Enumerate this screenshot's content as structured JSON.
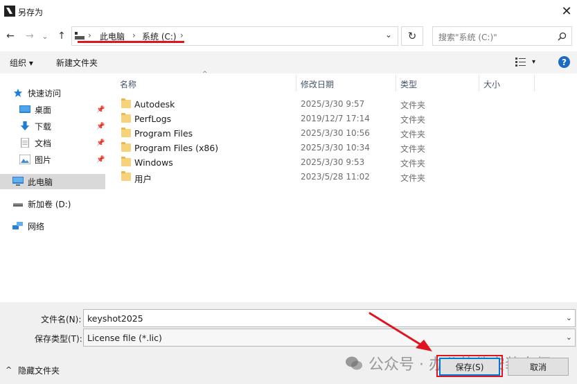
{
  "window": {
    "title": "另存为",
    "close": "✕"
  },
  "nav": {
    "back": "←",
    "forward": "→",
    "recent": "⌄",
    "up": "↑"
  },
  "address": {
    "segments": [
      "此电脑",
      "系统 (C:)"
    ],
    "separator": "›",
    "refresh": "↻",
    "dropdown": "⌄"
  },
  "search": {
    "placeholder": "搜索\"系统 (C:)\""
  },
  "toolbar": {
    "organize": "组织 ▾",
    "new_folder": "新建文件夹",
    "view_arrow": "▾",
    "help": "?"
  },
  "sidebar": {
    "quick_access": "快速访问",
    "items": [
      {
        "label": "桌面",
        "icon": "desktop-icon",
        "pinned": true
      },
      {
        "label": "下载",
        "icon": "download-icon",
        "pinned": true
      },
      {
        "label": "文档",
        "icon": "document-icon",
        "pinned": true
      },
      {
        "label": "图片",
        "icon": "pictures-icon",
        "pinned": true
      }
    ],
    "this_pc": "此电脑",
    "drive_d": "新加卷 (D:)",
    "network": "网络"
  },
  "columns": {
    "name": "名称",
    "date": "修改日期",
    "type": "类型",
    "size": "大小"
  },
  "files": [
    {
      "name": "Autodesk",
      "date": "2025/3/30 9:57",
      "type": "文件夹"
    },
    {
      "name": "PerfLogs",
      "date": "2019/12/7 17:14",
      "type": "文件夹"
    },
    {
      "name": "Program Files",
      "date": "2025/3/30 10:56",
      "type": "文件夹"
    },
    {
      "name": "Program Files (x86)",
      "date": "2025/3/30 10:34",
      "type": "文件夹"
    },
    {
      "name": "Windows",
      "date": "2025/3/30 9:53",
      "type": "文件夹"
    },
    {
      "name": "用户",
      "date": "2023/5/28 11:02",
      "type": "文件夹"
    }
  ],
  "form": {
    "filename_label": "文件名(N):",
    "filename_value": "keyshot2025",
    "filetype_label": "保存类型(T):",
    "filetype_value": "License file (*.lic)"
  },
  "footer": {
    "hide_folders": "隐藏文件夹",
    "save": "保存(S)",
    "cancel": "取消"
  },
  "watermark": "公众号 · 办公软件安装大师",
  "colors": {
    "accent": "#0078d7",
    "annotation": "#e0141e",
    "folder": "#f6d37a"
  }
}
